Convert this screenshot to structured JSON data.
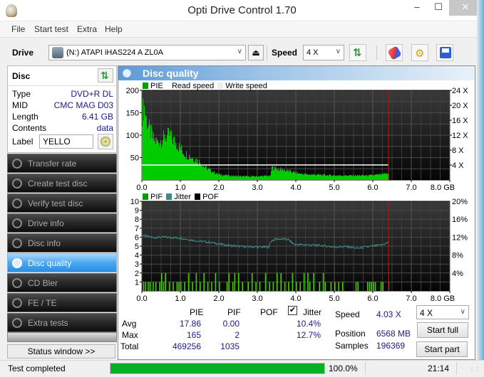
{
  "window": {
    "title": "Opti Drive Control 1.70",
    "min": "–",
    "max": "☐",
    "close": "✕"
  },
  "menu": [
    "File",
    "Start test",
    "Extra",
    "Help"
  ],
  "toolbar": {
    "drive_label": "Drive",
    "drive_value": "(N:)   ATAPI iHAS224   A ZL0A",
    "speed_label": "Speed",
    "speed_value": "4 X",
    "eject_glyph": "⏏",
    "refresh_glyph": "⇅",
    "settings_glyph": "⚙"
  },
  "disc": {
    "header": "Disc",
    "rows": [
      {
        "key": "Type",
        "value": "DVD+R DL"
      },
      {
        "key": "MID",
        "value": "CMC MAG D03"
      },
      {
        "key": "Length",
        "value": "6.41 GB"
      },
      {
        "key": "Contents",
        "value": "data"
      }
    ],
    "label_key": "Label",
    "label_value": "YELLO"
  },
  "nav": [
    {
      "label": "Transfer rate",
      "active": false
    },
    {
      "label": "Create test disc",
      "active": false
    },
    {
      "label": "Verify test disc",
      "active": false
    },
    {
      "label": "Drive info",
      "active": false
    },
    {
      "label": "Disc info",
      "active": false
    },
    {
      "label": "Disc quality",
      "active": true
    },
    {
      "label": "CD Bler",
      "active": false
    },
    {
      "label": "FE / TE",
      "active": false
    },
    {
      "label": "Extra tests",
      "active": false
    }
  ],
  "status_window_button": "Status window >>",
  "panel": {
    "title": "Disc quality"
  },
  "chart_data": [
    {
      "type": "area",
      "title": "",
      "legend": [
        "PIE",
        "Read speed",
        "Write speed"
      ],
      "legend_colors": {
        "PIE": "#00a000",
        "Read speed": "#ffffff",
        "Write speed": "#eeeeee"
      },
      "legend_placement": "top-left",
      "xlabel": "GB",
      "x_ticks": [
        "0.0",
        "1.0",
        "2.0",
        "3.0",
        "4.0",
        "5.0",
        "6.0",
        "7.0",
        "8.0 GB"
      ],
      "xlim": [
        0,
        8
      ],
      "ylim_left": [
        0,
        200
      ],
      "y_ticks_left": [
        "200",
        "150",
        "100",
        "50"
      ],
      "ylim_right": [
        0,
        24
      ],
      "y_ticks_right": [
        "24 X",
        "20 X",
        "16 X",
        "12 X",
        "8 X",
        "4 X"
      ],
      "end_marker_x": 6.41,
      "series": [
        {
          "name": "PIE",
          "color": "#00cc00",
          "x": [
            0.0,
            0.05,
            0.1,
            0.15,
            0.2,
            0.3,
            0.4,
            0.5,
            0.6,
            0.7,
            0.8,
            0.9,
            1.0,
            1.1,
            1.2,
            1.3,
            1.4,
            1.5,
            1.6,
            1.7,
            1.8,
            1.9,
            2.0,
            2.2,
            2.4,
            2.6,
            2.8,
            3.0,
            3.2,
            3.34,
            3.36,
            3.5,
            3.7,
            3.9,
            4.1,
            4.3,
            4.5,
            4.7,
            5.0,
            5.3,
            5.6,
            5.9,
            6.2,
            6.4
          ],
          "values": [
            150,
            165,
            140,
            125,
            110,
            90,
            85,
            90,
            95,
            100,
            90,
            80,
            70,
            60,
            55,
            50,
            45,
            40,
            30,
            25,
            20,
            15,
            12,
            10,
            9,
            8,
            8,
            8,
            9,
            9,
            28,
            25,
            22,
            18,
            14,
            12,
            12,
            11,
            10,
            10,
            10,
            10,
            12,
            14
          ]
        },
        {
          "name": "Read speed",
          "color": "#ffffff",
          "x": [
            0.0,
            6.41
          ],
          "values": [
            4.0,
            4.03
          ]
        }
      ]
    },
    {
      "type": "bar",
      "title": "",
      "legend": [
        "PIF",
        "Jitter",
        "POF"
      ],
      "legend_colors": {
        "PIF": "#00a000",
        "Jitter": "#3a8a8a",
        "POF": "#000000"
      },
      "legend_placement": "top-left",
      "xlabel": "GB",
      "x_ticks": [
        "0.0",
        "1.0",
        "2.0",
        "3.0",
        "4.0",
        "5.0",
        "6.0",
        "7.0",
        "8.0 GB"
      ],
      "xlim": [
        0,
        8
      ],
      "ylim_left": [
        0,
        10
      ],
      "y_ticks_left": [
        "10",
        "9",
        "8",
        "7",
        "6",
        "5",
        "4",
        "3",
        "2",
        "1"
      ],
      "ylim_right": [
        0,
        20
      ],
      "y_ticks_right": [
        "20%",
        "16%",
        "12%",
        "8%",
        "4%"
      ],
      "end_marker_x": 6.41,
      "series": [
        {
          "name": "Jitter",
          "color": "#3f8f8f",
          "unit": "%",
          "x": [
            0.0,
            0.3,
            0.6,
            1.0,
            1.4,
            1.8,
            2.2,
            2.6,
            3.0,
            3.3,
            3.36,
            3.5,
            3.8,
            3.95,
            4.3,
            4.7,
            5.0,
            5.3,
            5.6,
            5.9,
            6.2,
            6.41
          ],
          "values": [
            12.4,
            11.9,
            12.0,
            11.8,
            11.2,
            10.8,
            10.2,
            9.9,
            9.8,
            9.8,
            11.2,
            11.6,
            11.5,
            10.4,
            10.3,
            10.1,
            9.8,
            9.9,
            9.5,
            9.9,
            10.2,
            10.8
          ]
        },
        {
          "name": "PIF",
          "color": "#44cc00",
          "x": [
            0.03,
            0.08,
            0.15,
            0.2,
            0.28,
            0.35,
            0.45,
            0.5,
            0.55,
            0.6,
            0.7,
            0.8,
            0.9,
            0.95,
            1.0,
            1.1,
            1.2,
            1.3,
            1.4,
            1.5,
            1.6,
            1.7,
            1.8,
            1.9,
            2.0,
            2.2,
            2.25,
            2.35,
            2.4,
            2.5,
            2.6,
            2.75,
            2.85,
            2.95,
            3.05,
            3.2,
            3.3,
            3.4,
            3.5,
            3.6,
            3.7,
            3.8,
            3.9,
            4.0,
            4.1,
            4.2,
            4.3,
            4.35,
            4.45,
            4.6,
            4.7,
            4.75,
            4.9,
            5.0,
            5.1,
            5.2,
            5.55,
            5.6,
            5.85,
            5.9,
            5.95,
            6.0,
            6.05,
            6.2,
            6.25,
            6.4
          ],
          "values": [
            1,
            1,
            1,
            1,
            1,
            1,
            1,
            2,
            1,
            2,
            1,
            1,
            1,
            1,
            1,
            1,
            2,
            1,
            2,
            1,
            2,
            1,
            1,
            2,
            1,
            1,
            2,
            1,
            2,
            2,
            1,
            1,
            2,
            1,
            1,
            2,
            1,
            1,
            2,
            2,
            1,
            1,
            2,
            1,
            1,
            2,
            2,
            1,
            2,
            1,
            2,
            1,
            1,
            1,
            1,
            1,
            1,
            1,
            1,
            1,
            1,
            1,
            1,
            1,
            1,
            1
          ]
        },
        {
          "name": "POF",
          "color": "#000000",
          "x": [],
          "values": []
        }
      ]
    }
  ],
  "stats": {
    "headers": [
      "PIE",
      "PIF",
      "POF",
      "Jitter"
    ],
    "jitter_checked": true,
    "rows": [
      {
        "label": "Avg",
        "pie": "17.86",
        "pif": "0.00",
        "pof": "",
        "jitter": "10.4%"
      },
      {
        "label": "Max",
        "pie": "165",
        "pif": "2",
        "pof": "",
        "jitter": "12.7%"
      },
      {
        "label": "Total",
        "pie": "469256",
        "pif": "1035",
        "pof": "",
        "jitter": ""
      }
    ]
  },
  "run": {
    "speed_label": "Speed",
    "speed_value": "4.03 X",
    "position_label": "Position",
    "position_value": "6568 MB",
    "samples_label": "Samples",
    "samples_value": "196369",
    "speed_select": "4 X",
    "start_full": "Start full",
    "start_part": "Start part"
  },
  "statusbar": {
    "text": "Test completed",
    "progress": 1.0,
    "progress_text": "100.0%",
    "time": "21:14"
  },
  "colors": {
    "accent": "#2d8ce0",
    "pie": "#00cc00",
    "pif": "#44cc00",
    "jitter": "#3f8f8f",
    "marker": "#dd0000",
    "progress": "#06b025"
  }
}
